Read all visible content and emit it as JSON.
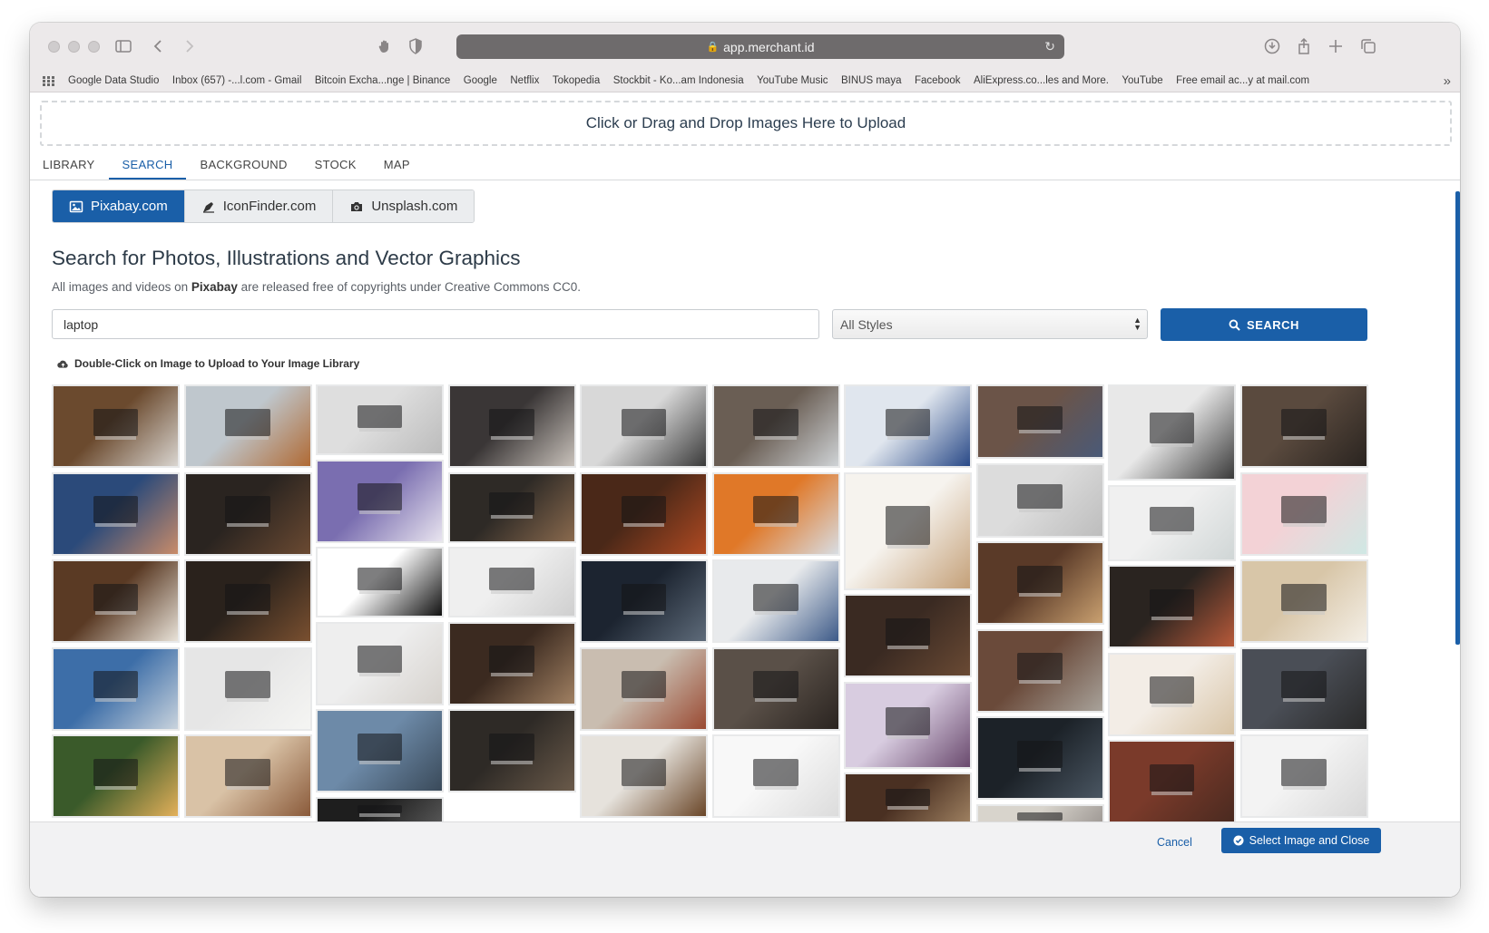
{
  "browser": {
    "url": "app.merchant.id",
    "bookmarks": [
      "Google Data Studio",
      "Inbox (657) -...l.com - Gmail",
      "Bitcoin Excha...nge | Binance",
      "Google",
      "Netflix",
      "Tokopedia",
      "Stockbit - Ko...am Indonesia",
      "YouTube Music",
      "BINUS maya",
      "Facebook",
      "AliExpress.co...les and More.",
      "YouTube",
      "Free email ac...y at mail.com"
    ],
    "more": "»"
  },
  "upload": {
    "dropzone_text": "Click or Drag and Drop Images Here to Upload"
  },
  "tabs": [
    "LIBRARY",
    "SEARCH",
    "BACKGROUND",
    "STOCK",
    "MAP"
  ],
  "active_tab": "SEARCH",
  "providers": [
    {
      "label": "Pixabay.com",
      "icon": "image-icon",
      "active": true
    },
    {
      "label": "IconFinder.com",
      "icon": "pen-nib-icon",
      "active": false
    },
    {
      "label": "Unsplash.com",
      "icon": "camera-icon",
      "active": false
    }
  ],
  "search": {
    "heading": "Search for Photos, Illustrations and Vector Graphics",
    "sub_prefix": "All images and videos on ",
    "sub_brand": "Pixabay",
    "sub_suffix": " are released free of copyrights under Creative Commons CC0.",
    "query": "laptop",
    "style_selected": "All Styles",
    "button_label": "SEARCH",
    "hint": "Double-Click on Image to Upload to Your Image Library"
  },
  "gallery": {
    "columns": [
      [
        {
          "c1": "#6b4a2e",
          "c2": "#d9d5d0"
        },
        {
          "c1": "#2b4a7a",
          "c2": "#c98c6a"
        },
        {
          "c1": "#5a3a24",
          "c2": "#e8e2d8"
        },
        {
          "c1": "#3d6ea8",
          "c2": "#c9d3dd"
        },
        {
          "c1": "#3a5a2a",
          "c2": "#e3b05a"
        }
      ],
      [
        {
          "c1": "#bfc7cd",
          "c2": "#b06a34"
        },
        {
          "c1": "#2a2420",
          "c2": "#6b4a32"
        },
        {
          "c1": "#2a221c",
          "c2": "#7a5030"
        },
        {
          "c1": "#e6e6e6",
          "c2": "#f5f5f3"
        },
        {
          "c1": "#d9c2a6",
          "c2": "#8a5a3a"
        }
      ],
      [
        {
          "c1": "#dedede",
          "c2": "#bcbcbc"
        },
        {
          "c1": "#7a6eb0",
          "c2": "#e8e4ef"
        },
        {
          "c1": "#ffffff",
          "c2": "#111111"
        },
        {
          "c1": "#eeeeee",
          "c2": "#d6d2cd"
        },
        {
          "c1": "#6d8aa8",
          "c2": "#3a4a5a"
        },
        {
          "c1": "#1e1e1e",
          "c2": "#555555"
        }
      ],
      [
        {
          "c1": "#3a3636",
          "c2": "#c9c2bb"
        },
        {
          "c1": "#2e2a26",
          "c2": "#8a6a4e"
        },
        {
          "c1": "#efefef",
          "c2": "#cfcfcf"
        },
        {
          "c1": "#3b2a20",
          "c2": "#a08062"
        },
        {
          "c1": "#2e2a26",
          "c2": "#6a5a4a"
        }
      ],
      [
        {
          "c1": "#d8d8d8",
          "c2": "#3a3a3a"
        },
        {
          "c1": "#4a2818",
          "c2": "#b04a22"
        },
        {
          "c1": "#1c2430",
          "c2": "#5e6b7a"
        },
        {
          "c1": "#c9bdb0",
          "c2": "#9a4a32"
        },
        {
          "c1": "#e6e2dc",
          "c2": "#6a4628"
        }
      ],
      [
        {
          "c1": "#6a5e54",
          "c2": "#cfd3d6"
        },
        {
          "c1": "#e07828",
          "c2": "#d8dde3"
        },
        {
          "c1": "#e8eaec",
          "c2": "#3d5a88"
        },
        {
          "c1": "#5a5048",
          "c2": "#2a2420"
        },
        {
          "c1": "#f8f8f8",
          "c2": "#dcdcdc"
        }
      ],
      [
        {
          "c1": "#e0e6ee",
          "c2": "#2a4a88"
        },
        {
          "c1": "#f6f3ee",
          "c2": "#c4a078"
        },
        {
          "c1": "#3a2a22",
          "c2": "#6a4a34"
        },
        {
          "c1": "#d8cce0",
          "c2": "#6a4a6e"
        },
        {
          "c1": "#4a3022",
          "c2": "#a08262"
        }
      ],
      [
        {
          "c1": "#6b5448",
          "c2": "#4a5a78"
        },
        {
          "c1": "#dcdcdc",
          "c2": "#bdbdbd"
        },
        {
          "c1": "#5a3a28",
          "c2": "#c9a070"
        },
        {
          "c1": "#6a4a3a",
          "c2": "#a8a29a"
        },
        {
          "c1": "#1c2228",
          "c2": "#4a5662"
        },
        {
          "c1": "#d8d4cc",
          "c2": "#9a9490"
        }
      ],
      [
        {
          "c1": "#e8e8e8",
          "c2": "#3a3a3a"
        },
        {
          "c1": "#f0f0f0",
          "c2": "#d0d6d6"
        },
        {
          "c1": "#2a2420",
          "c2": "#b85a3a"
        },
        {
          "c1": "#f3ede6",
          "c2": "#d8c4a6"
        },
        {
          "c1": "#7a3a2a",
          "c2": "#4a2a20"
        }
      ],
      [
        {
          "c1": "#5a4a3e",
          "c2": "#2a2420"
        },
        {
          "c1": "#f3d2d6",
          "c2": "#cfe8e4"
        },
        {
          "c1": "#d8c6a8",
          "c2": "#f4efe6"
        },
        {
          "c1": "#4a4e56",
          "c2": "#2a2a2a"
        },
        {
          "c1": "#f3f3f3",
          "c2": "#d8d8d8"
        }
      ]
    ]
  },
  "footer": {
    "cancel_label": "Cancel",
    "select_label": "Select Image and Close"
  }
}
